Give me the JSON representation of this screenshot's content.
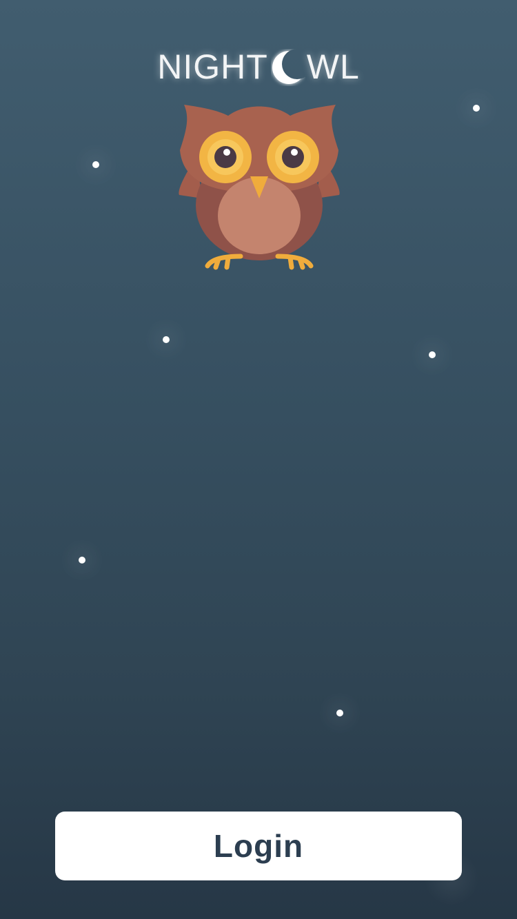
{
  "app": {
    "logo_left": "NIGHT",
    "logo_right": "WL",
    "logo_moon_icon": "crescent-moon-icon",
    "mascot_icon": "owl-icon"
  },
  "actions": {
    "login_label": "Login"
  },
  "colors": {
    "background_top": "#415d6f",
    "background_bottom": "#263746",
    "button_text": "#2c3e50",
    "owl_body": "#8f5249",
    "owl_head": "#a8624f",
    "owl_belly": "#c4846e",
    "owl_eye_ring": "#f2b544",
    "owl_feet": "#f0ac3c"
  }
}
